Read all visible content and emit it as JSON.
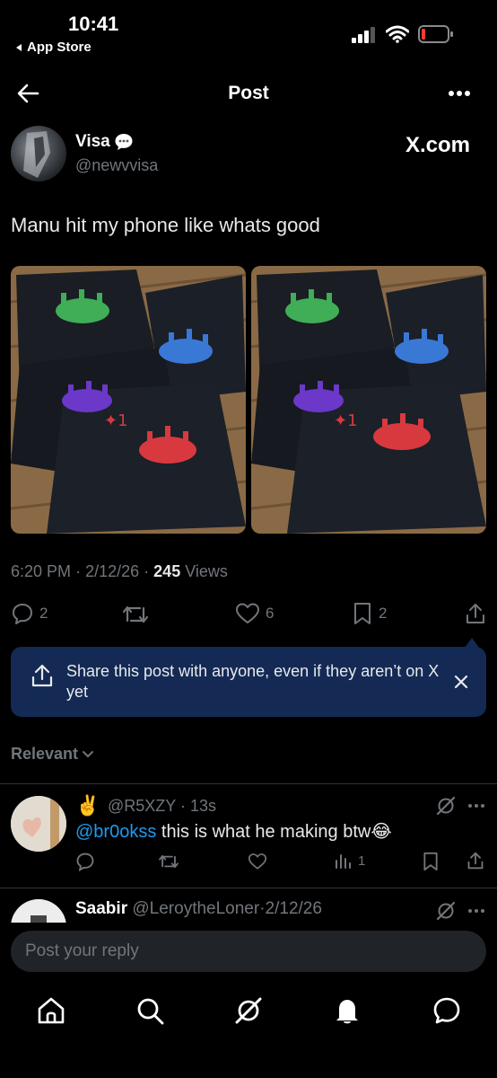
{
  "status_bar": {
    "time": "10:41",
    "back_app": "App Store"
  },
  "header": {
    "title": "Post"
  },
  "post": {
    "author_name": "Visa",
    "author_handle": "@newvvisa",
    "source_label": "X.com",
    "text": "Manu hit my phone like whats good",
    "time": "6:20 PM",
    "sep1": "·",
    "date": "2/12/26",
    "sep2": "·",
    "views_count": "245",
    "views_label": "Views",
    "replies": "2",
    "likes": "6",
    "bookmarks": "2"
  },
  "share_banner": {
    "text": "Share this post with anyone, even if they aren’t on X yet"
  },
  "replies_sort": {
    "label": "Relevant"
  },
  "replies": [
    {
      "emoji": "✌️",
      "handle": "@R5XZY",
      "sep": "·",
      "time": "13s",
      "mention": "@br0okss",
      "text": " this is what he making btw",
      "text_emoji": "😂",
      "views": "1"
    },
    {
      "name": "Saabir",
      "handle": "@LeroytheLoner",
      "sep": "·",
      "time": "2/12/26"
    }
  ],
  "reply_box": {
    "placeholder": "Post your reply"
  },
  "icons": [
    "back-arrow-icon",
    "more-icon",
    "signal-icon",
    "wifi-icon",
    "battery-icon",
    "chat-bubble-icon",
    "reply-icon",
    "repost-icon",
    "like-icon",
    "bookmark-icon",
    "share-icon",
    "close-icon",
    "chevron-down-icon",
    "grok-icon",
    "views-icon",
    "home-icon",
    "search-icon",
    "notifications-icon",
    "messages-icon"
  ],
  "colors": {
    "background": "#000000",
    "text": "#e7e9ea",
    "muted": "#71767b",
    "link": "#1d9bf0",
    "share_banner": "#142a55",
    "divider": "#2f3336",
    "input": "#202327"
  }
}
